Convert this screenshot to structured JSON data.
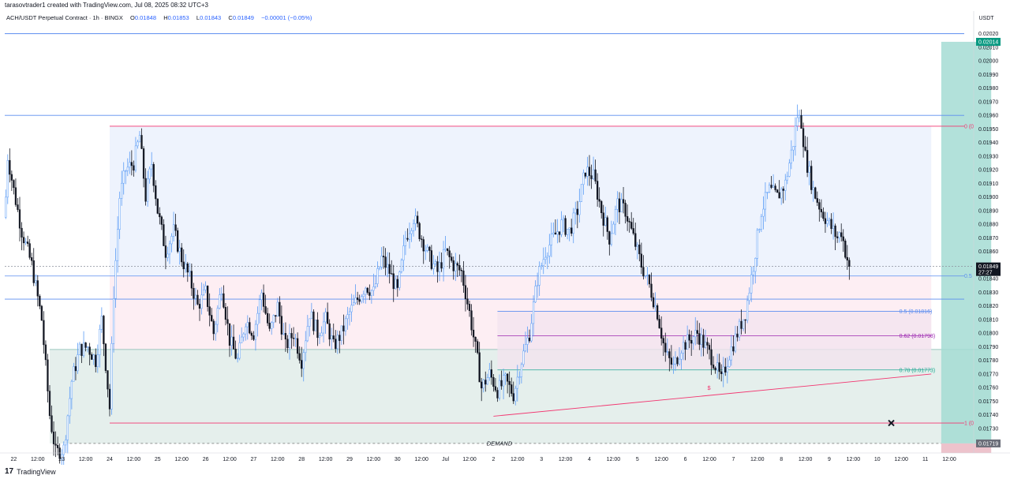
{
  "header": {
    "caption": "tarasovtrader1 created with TradingView.com, Jul 08, 2025 08:32 UTC+3"
  },
  "legend": {
    "symbol": "ACH/USDT Perpetual Contract · 1h · BINGX",
    "open_label": "O",
    "open": "0.01848",
    "high_label": "H",
    "high": "0.01853",
    "low_label": "L",
    "low": "0.01843",
    "close_label": "C",
    "close": "0.01849",
    "change": "−0.00001 (−0.05%)"
  },
  "footer": {
    "brand": "TradingView",
    "brand_icon": "tradingview-logo-icon"
  },
  "colors": {
    "up_wick": "#5b9cf6",
    "down_body": "#131722",
    "blue_line": "#5b8def",
    "fib_red": "#f23670",
    "range_fill": "#eef3fd",
    "premium_fill": "#fdeef3",
    "demand_fill": "#e0ece9",
    "target_fill": "#a5dcd3",
    "stop_fill": "#eab9c3",
    "price_tag": "#131722",
    "target_tag": "#089981"
  },
  "chart_data": {
    "type": "candlestick",
    "currency": "USDT",
    "y_ticks": [
      "0.02020",
      "0.02010",
      "0.02000",
      "0.01990",
      "0.01980",
      "0.01970",
      "0.01960",
      "0.01950",
      "0.01940",
      "0.01930",
      "0.01920",
      "0.01910",
      "0.01900",
      "0.01890",
      "0.01880",
      "0.01870",
      "0.01860",
      "0.01850",
      "0.01840",
      "0.01830",
      "0.01820",
      "0.01810",
      "0.01800",
      "0.01790",
      "0.01780",
      "0.01770",
      "0.01760",
      "0.01750",
      "0.01740",
      "0.01730",
      "0.01720"
    ],
    "ylim": [
      0.01712,
      0.02025
    ],
    "x_ticks": [
      "22",
      "12:00",
      "23",
      "12:00",
      "24",
      "12:00",
      "25",
      "12:00",
      "26",
      "12:00",
      "27",
      "12:00",
      "28",
      "12:00",
      "29",
      "12:00",
      "30",
      "12:00",
      "Jul",
      "12:00",
      "2",
      "12:00",
      "3",
      "12:00",
      "4",
      "12:00",
      "5",
      "12:00",
      "6",
      "12:00",
      "7",
      "12:00",
      "8",
      "12:00",
      "9",
      "12:00",
      "10",
      "12:00",
      "11",
      "12:00"
    ],
    "x_tick_hours": [
      0,
      12,
      24,
      36,
      48,
      60,
      72,
      84,
      96,
      108,
      120,
      132,
      144,
      156,
      168,
      180,
      192,
      204,
      216,
      228,
      240,
      252,
      264,
      276,
      288,
      300,
      312,
      324,
      336,
      348,
      360,
      372,
      384,
      396,
      408,
      420,
      432,
      444,
      456,
      468
    ],
    "x_start_hour": -4.5,
    "x_end_hour": 475.5,
    "anchors": [
      [
        -4.5,
        0.01885
      ],
      [
        -3,
        0.0193
      ],
      [
        0,
        0.01905
      ],
      [
        4,
        0.01875
      ],
      [
        9,
        0.0185
      ],
      [
        14,
        0.0181
      ],
      [
        18,
        0.0174
      ],
      [
        21,
        0.01712
      ],
      [
        25,
        0.01715
      ],
      [
        29,
        0.01765
      ],
      [
        33,
        0.01788
      ],
      [
        37,
        0.0179
      ],
      [
        41,
        0.0178
      ],
      [
        44,
        0.0181
      ],
      [
        48,
        0.01745
      ],
      [
        50,
        0.0183
      ],
      [
        53,
        0.019
      ],
      [
        56,
        0.0192
      ],
      [
        60,
        0.01925
      ],
      [
        63,
        0.01945
      ],
      [
        66,
        0.019
      ],
      [
        69,
        0.01925
      ],
      [
        72,
        0.0189
      ],
      [
        76,
        0.0186
      ],
      [
        80,
        0.01875
      ],
      [
        84,
        0.01855
      ],
      [
        88,
        0.0184
      ],
      [
        92,
        0.0182
      ],
      [
        96,
        0.0183
      ],
      [
        100,
        0.018
      ],
      [
        104,
        0.01835
      ],
      [
        108,
        0.01795
      ],
      [
        112,
        0.0178
      ],
      [
        116,
        0.0181
      ],
      [
        120,
        0.018
      ],
      [
        124,
        0.0183
      ],
      [
        128,
        0.018
      ],
      [
        132,
        0.0182
      ],
      [
        136,
        0.0179
      ],
      [
        140,
        0.018
      ],
      [
        144,
        0.0178
      ],
      [
        148,
        0.01815
      ],
      [
        152,
        0.018
      ],
      [
        156,
        0.0181
      ],
      [
        160,
        0.0179
      ],
      [
        164,
        0.018
      ],
      [
        168,
        0.01815
      ],
      [
        172,
        0.01825
      ],
      [
        176,
        0.01835
      ],
      [
        180,
        0.0183
      ],
      [
        184,
        0.01855
      ],
      [
        188,
        0.01845
      ],
      [
        192,
        0.0183
      ],
      [
        196,
        0.0187
      ],
      [
        200,
        0.01885
      ],
      [
        204,
        0.0187
      ],
      [
        208,
        0.01855
      ],
      [
        212,
        0.01845
      ],
      [
        216,
        0.0186
      ],
      [
        220,
        0.0185
      ],
      [
        224,
        0.01845
      ],
      [
        228,
        0.01815
      ],
      [
        232,
        0.0178
      ],
      [
        234,
        0.0176
      ],
      [
        238,
        0.0177
      ],
      [
        242,
        0.01758
      ],
      [
        246,
        0.01765
      ],
      [
        250,
        0.01755
      ],
      [
        254,
        0.0178
      ],
      [
        258,
        0.018
      ],
      [
        262,
        0.0184
      ],
      [
        266,
        0.0186
      ],
      [
        270,
        0.0187
      ],
      [
        274,
        0.0188
      ],
      [
        278,
        0.01875
      ],
      [
        282,
        0.0189
      ],
      [
        286,
        0.0192
      ],
      [
        290,
        0.01915
      ],
      [
        294,
        0.0189
      ],
      [
        298,
        0.0187
      ],
      [
        302,
        0.01895
      ],
      [
        306,
        0.0189
      ],
      [
        310,
        0.0187
      ],
      [
        314,
        0.0185
      ],
      [
        318,
        0.01835
      ],
      [
        322,
        0.01815
      ],
      [
        326,
        0.01785
      ],
      [
        330,
        0.01775
      ],
      [
        334,
        0.0179
      ],
      [
        338,
        0.01795
      ],
      [
        342,
        0.018
      ],
      [
        346,
        0.0179
      ],
      [
        350,
        0.0178
      ],
      [
        354,
        0.01765
      ],
      [
        358,
        0.01785
      ],
      [
        362,
        0.018
      ],
      [
        366,
        0.01815
      ],
      [
        370,
        0.0185
      ],
      [
        374,
        0.0189
      ],
      [
        378,
        0.01905
      ],
      [
        382,
        0.019
      ],
      [
        386,
        0.0191
      ],
      [
        390,
        0.0194
      ],
      [
        392,
        0.0196
      ],
      [
        394,
        0.01955
      ],
      [
        396,
        0.0193
      ],
      [
        400,
        0.01905
      ],
      [
        404,
        0.0189
      ],
      [
        408,
        0.0188
      ],
      [
        412,
        0.0187
      ],
      [
        414,
        0.01875
      ],
      [
        416,
        0.0186
      ],
      [
        418,
        0.01849
      ]
    ],
    "levels": {
      "top_line": 0.0202,
      "line_a": 0.0196,
      "line_b": 0.01849,
      "line_c": 0.01842,
      "line_d": 0.01825,
      "fib_0": 0.01952,
      "fib_half": 0.01842,
      "fib_1": 0.01734,
      "demand_top": 0.01788,
      "demand_line": 0.01719
    },
    "fib_labels": {
      "fib_0": "0 (0",
      "fib_half": "0.5",
      "fib_1": "1 (0"
    },
    "ote": {
      "start_hour": 240,
      "end_hour": 459,
      "levels": [
        {
          "label": "0.5 (0.01816)",
          "value": 0.01816,
          "color": "#5b8def"
        },
        {
          "label": "0.62 (0.01798)",
          "value": 0.01798,
          "color": "#9c27b0"
        },
        {
          "label": "0.78 (0.01773)",
          "value": 0.01773,
          "color": "#22ab94"
        }
      ]
    },
    "sweep": {
      "label": "$",
      "start_hour": 240,
      "start_value": 0.01739,
      "end_hour": 459,
      "end_value": 0.0177
    },
    "demand_label": "DEMAND",
    "target_price": 0.02014,
    "position_box": {
      "start_hour": 464,
      "end_hour": 489,
      "top": 0.02014,
      "entry": 0.01719,
      "stop_bottom": 0.01712
    },
    "cross_marker": {
      "hour": 439,
      "value": 0.01734
    },
    "last_price": "0.01849",
    "countdown": "27:27",
    "target_tag": "0.02014",
    "stop_tag": "0.01719"
  }
}
